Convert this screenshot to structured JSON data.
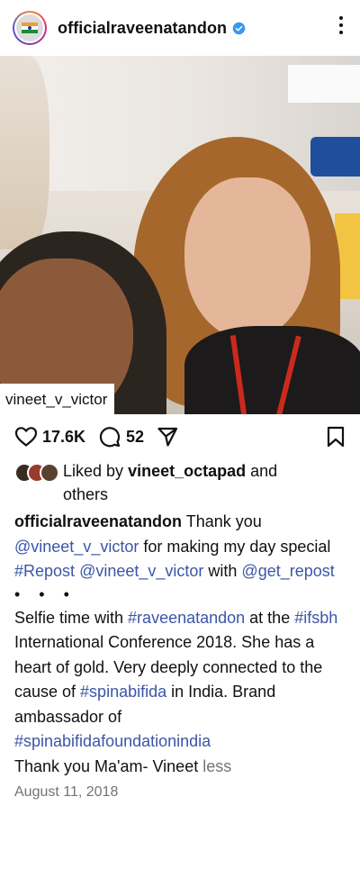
{
  "header": {
    "username": "officialraveenatandon",
    "verified": true
  },
  "photo": {
    "tag": "vineet_v_victor"
  },
  "actions": {
    "likes_count": "17.6K",
    "comments_count": "52"
  },
  "liked_by": {
    "prefix": "Liked by",
    "user": "vineet_octapad",
    "suffix": "and",
    "suffix2": "others"
  },
  "caption": {
    "author": "officialraveenatandon",
    "seg1": " Thank you ",
    "mention1": "@vineet_v_victor",
    "seg2": " for making my day special ",
    "hashtag_repost": "#Repost",
    "seg3": " ",
    "mention2": "@vineet_v_victor",
    "seg4": " with ",
    "mention3": "@get_repost",
    "ellipsis": "• • •",
    "body1": "Selfie time with ",
    "hashtag2": "#raveenatandon",
    "body2": " at the ",
    "hashtag3": "#ifsbh",
    "body3": " International Conference 2018. She has a heart of gold. Very deeply connected to the cause of ",
    "hashtag4": "#spinabifida",
    "body4": " in India. Brand ambassador of ",
    "hashtag5": "#spinabifidafoundationindia",
    "body5": "Thank you Ma'am- Vineet ",
    "less": "less"
  },
  "date": "August 11, 2018",
  "colors": {
    "link": "#3b56a8",
    "secondary_text": "#737373",
    "verified": "#3897f0"
  }
}
